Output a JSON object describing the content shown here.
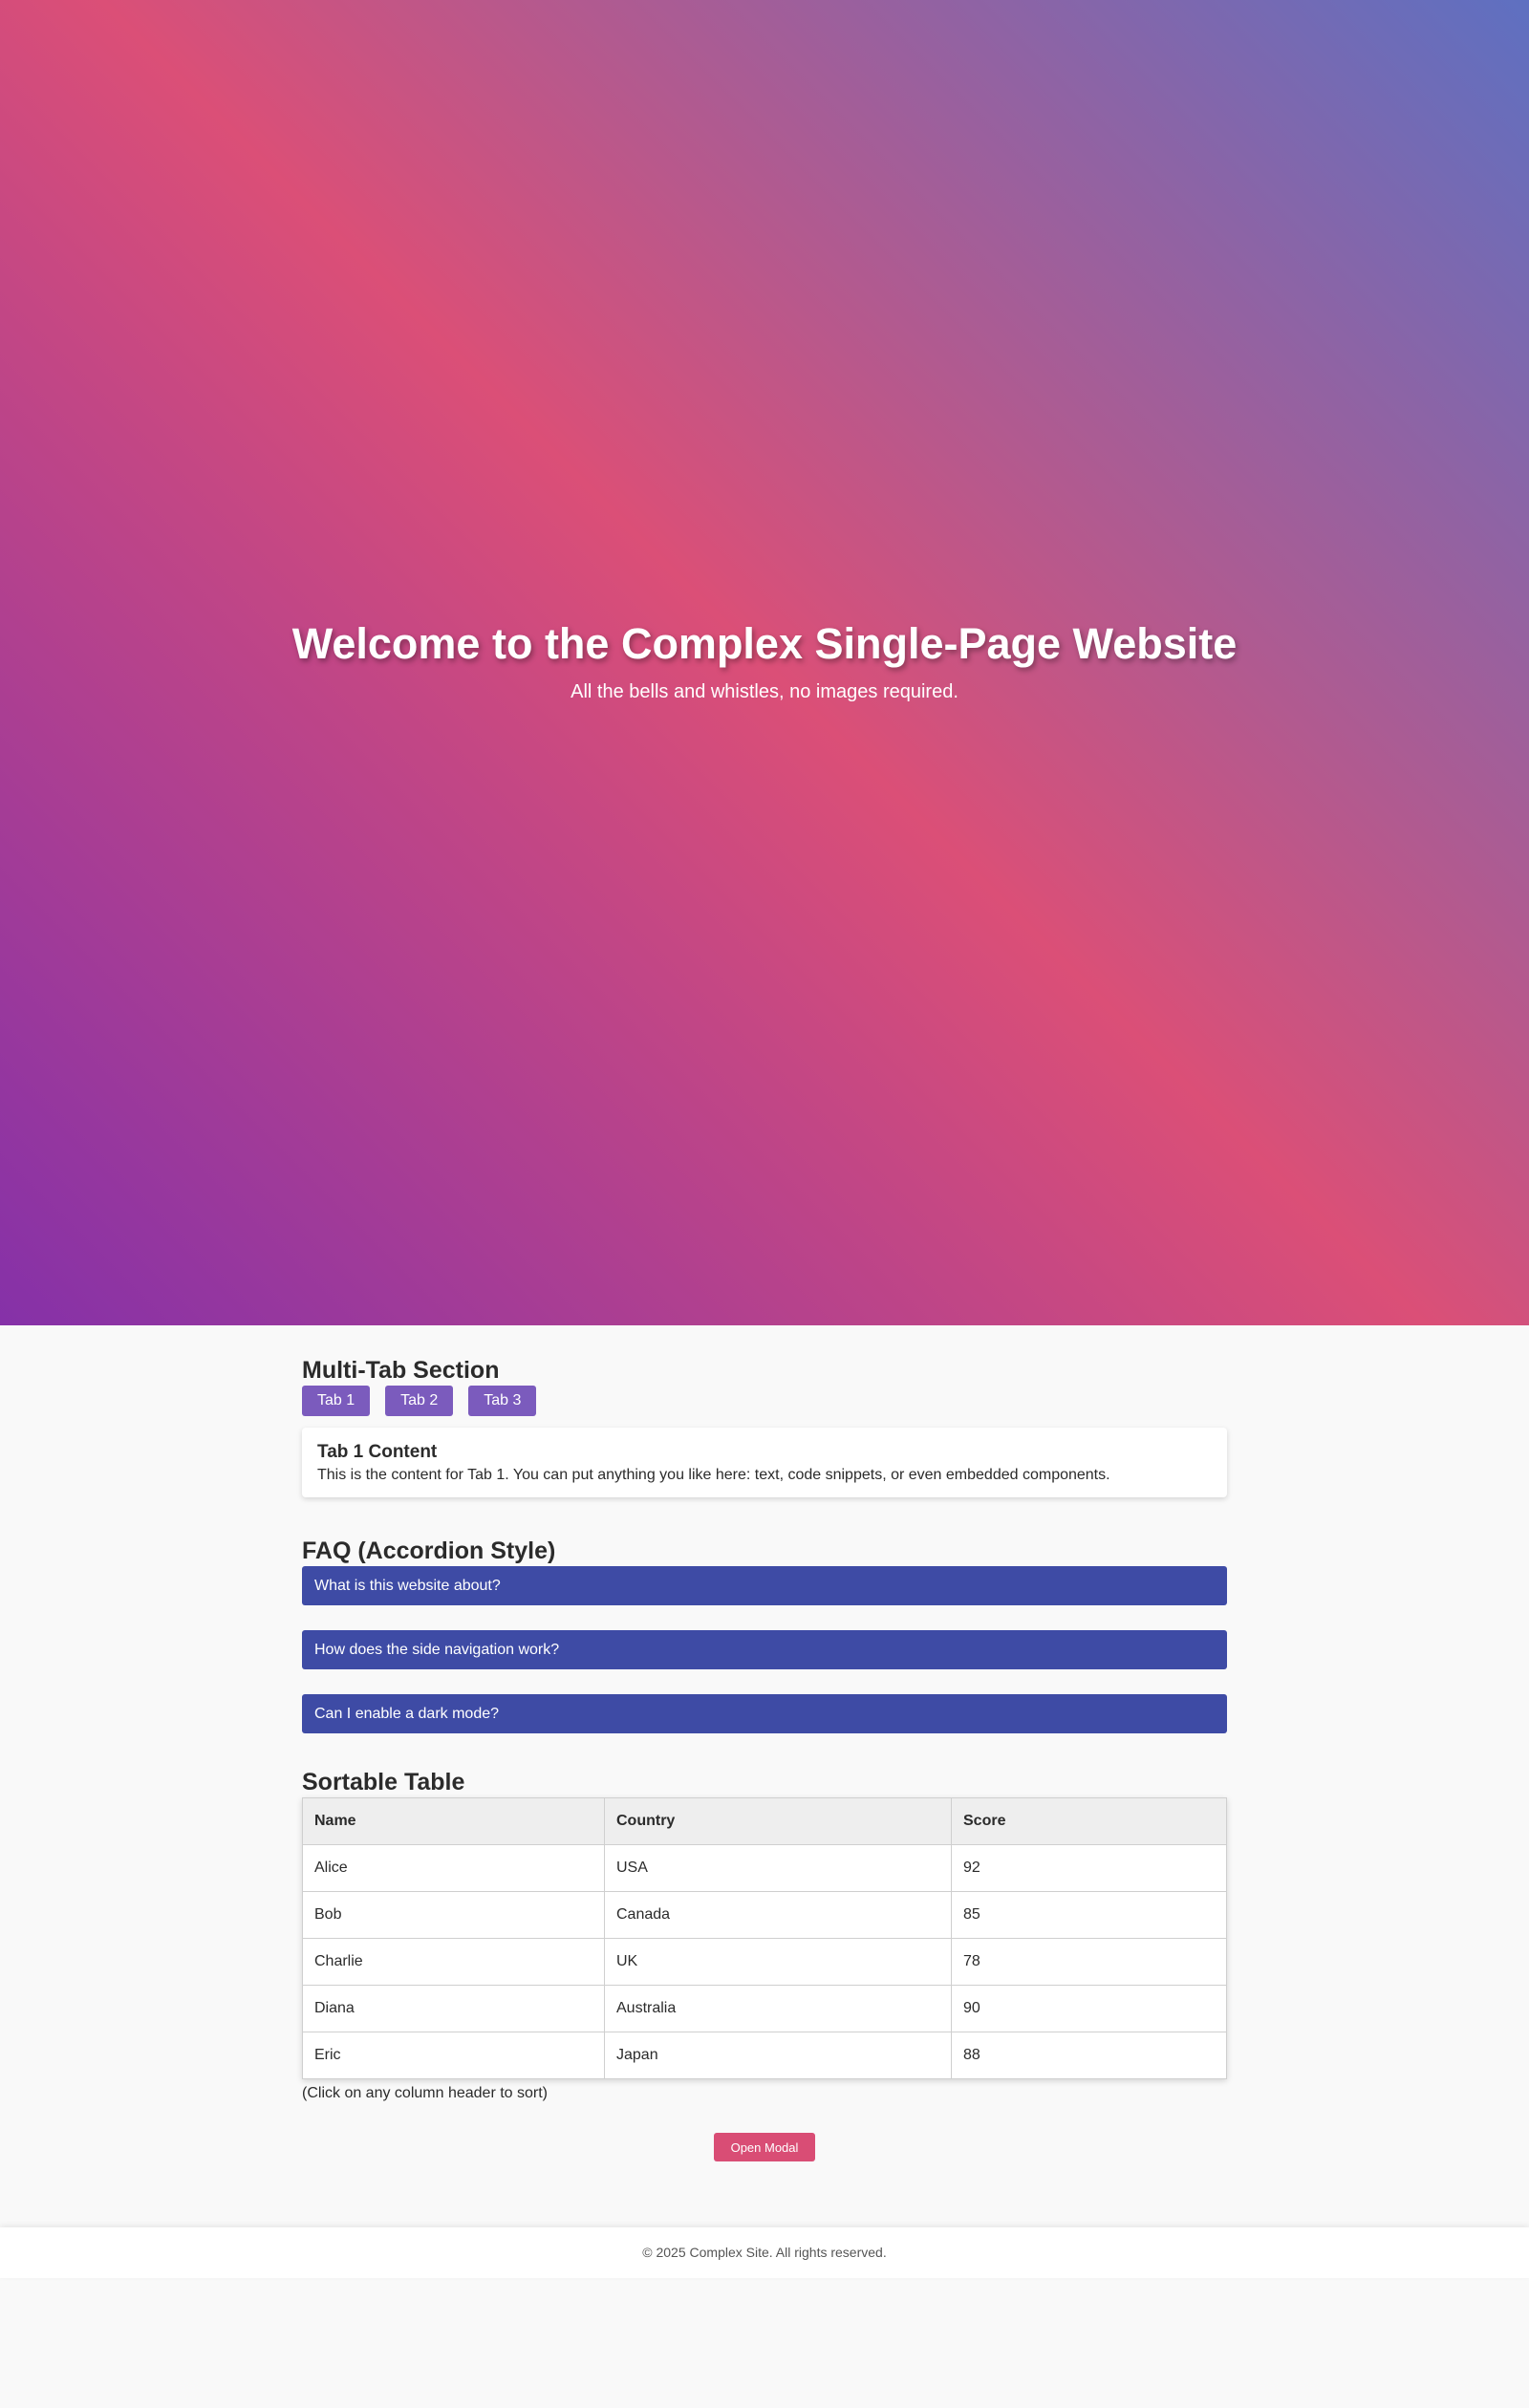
{
  "hero": {
    "title": "Welcome to the Complex Single-Page Website",
    "subtitle": "All the bells and whistles, no images required."
  },
  "tabs_section": {
    "title": "Multi-Tab Section",
    "tabs": [
      {
        "label": "Tab 1"
      },
      {
        "label": "Tab 2"
      },
      {
        "label": "Tab 3"
      }
    ],
    "active_tab": "Tab 1",
    "panel": {
      "title": "Tab 1 Content",
      "text": "This is the content for Tab 1. You can put anything you like here: text, code snippets, or even embedded components."
    }
  },
  "faq": {
    "title": "FAQ (Accordion Style)",
    "items": [
      {
        "question": "What is this website about?"
      },
      {
        "question": "How does the side navigation work?"
      },
      {
        "question": "Can I enable a dark mode?"
      }
    ]
  },
  "table": {
    "title": "Sortable Table",
    "headers": [
      "Name",
      "Country",
      "Score"
    ],
    "rows": [
      [
        "Alice",
        "USA",
        "92"
      ],
      [
        "Bob",
        "Canada",
        "85"
      ],
      [
        "Charlie",
        "UK",
        "78"
      ],
      [
        "Diana",
        "Australia",
        "90"
      ],
      [
        "Eric",
        "Japan",
        "88"
      ]
    ],
    "note": "(Click on any column header to sort)"
  },
  "modal": {
    "button_label": "Open Modal"
  },
  "footer": {
    "text": "© 2025 Complex Site. All rights reserved."
  },
  "colors": {
    "hero_gradient": [
      "#8531a8",
      "#db4f77",
      "#5e70c1"
    ],
    "tab_button": "#7b5bbd",
    "faq_item": "#3e4ba5",
    "modal_button": "#d94d75"
  }
}
